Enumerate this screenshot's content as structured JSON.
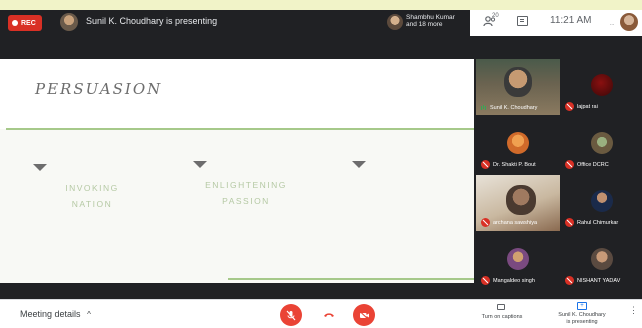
{
  "topbar": {
    "rec_label": "REC",
    "presenting_text": "Sunil K. Choudhary is presenting",
    "others_line1": "Shambhu Kumar",
    "others_line2": "and 18 more",
    "people_count": "20",
    "clock": "11:21 AM",
    "self_mini": "..."
  },
  "slide": {
    "title": "PERSUASION",
    "items": [
      {
        "line1": "INVOKING",
        "line2": "NATION"
      },
      {
        "line1": "ENLIGHTENING",
        "line2": "PASSION"
      }
    ]
  },
  "participants": [
    {
      "name": "Sunil K. Choudhary",
      "muted": false
    },
    {
      "name": "lajpat rai",
      "muted": true
    },
    {
      "name": "Dr. Shakti P. Bout",
      "muted": true
    },
    {
      "name": "Office DCRC",
      "muted": true
    },
    {
      "name": "archana sawshiya",
      "muted": true
    },
    {
      "name": "Rahul Chimurkar",
      "muted": true
    },
    {
      "name": "Mangaldeo singh",
      "muted": true
    },
    {
      "name": "NISHANT YADAV",
      "muted": true
    }
  ],
  "bottombar": {
    "meeting_details": "Meeting details",
    "chevron": "^",
    "captions_label": "Turn on captions",
    "present_line1": "Sunil K. Choudhary",
    "present_line2": "is presenting",
    "more_glyph": "⋮"
  },
  "colors": {
    "accent_red": "#ea4335",
    "slide_green": "#a6c98a",
    "muted_red": "#d93025"
  }
}
